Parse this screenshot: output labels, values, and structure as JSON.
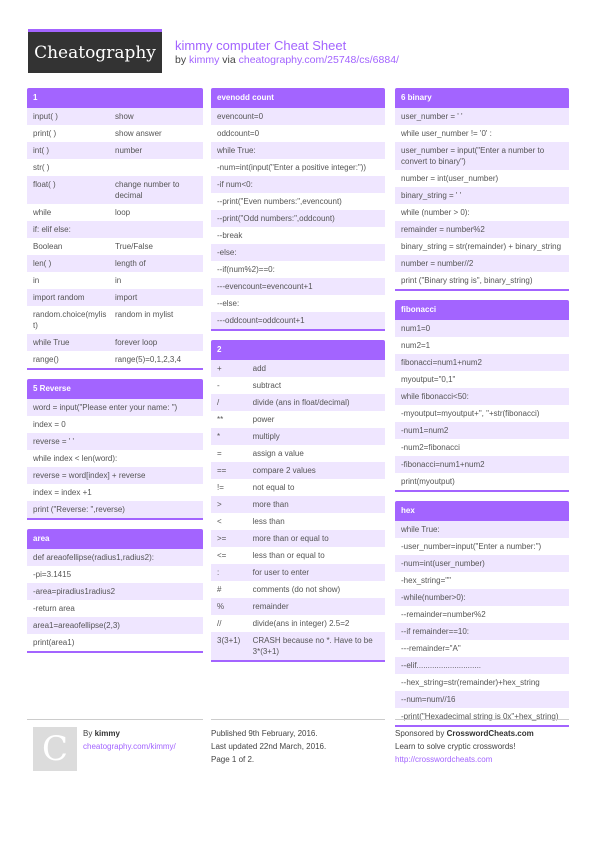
{
  "header": {
    "logo": "Cheatography",
    "title": "kimmy computer Cheat Sheet",
    "by": "by",
    "author": "kimmy",
    "via": "via",
    "url": "cheatography.com/25748/cs/6884/"
  },
  "sections": {
    "s1": {
      "title": "1",
      "rows": [
        [
          "input( )",
          "show"
        ],
        [
          "print( )",
          "show answer"
        ],
        [
          "int( )",
          "number"
        ],
        [
          "str( )",
          ""
        ],
        [
          "float( )",
          "change number to decimal"
        ],
        [
          "while",
          "loop"
        ],
        [
          "if: elif else:",
          ""
        ],
        [
          "Boolean",
          "True/False"
        ],
        [
          "len( )",
          "length of"
        ],
        [
          "in",
          "in"
        ],
        [
          "import random",
          "import"
        ],
        [
          "random.choice(mylist)",
          "random in mylist"
        ],
        [
          "while True",
          "forever loop"
        ],
        [
          "range()",
          "range(5)=0,1,2,3,4"
        ]
      ]
    },
    "reverse": {
      "title": "5 Reverse",
      "rows": [
        "word = input(\"Please enter your name: \")",
        "index = 0",
        "reverse = ' '",
        "while index < len(word):",
        "reverse = word[index] + reverse",
        "index = index +1",
        "print (\"Reverse: \",reverse)"
      ]
    },
    "area": {
      "title": "area",
      "rows": [
        "def areaofellipse(radius1,radius2):",
        "-pi=3.1415",
        "-area=piradius1radius2",
        "-return area",
        "area1=areaofellipse(2,3)",
        "print(area1)"
      ]
    },
    "evenodd": {
      "title": "evenodd count",
      "rows": [
        "evencount=0",
        "oddcount=0",
        "while True:",
        "-num=int(input(\"Enter a positive integer:\"))",
        "-if num<0:",
        "--print(\"Even numbers:\",evencount)",
        "--print(\"Odd numbers:\",oddcount)",
        "--break",
        "-else:",
        "--if(num%2)==0:",
        "---evencount=evencount+1",
        "--else:",
        "---oddcount=oddcount+1"
      ]
    },
    "s2": {
      "title": "2",
      "rows": [
        [
          "+",
          "add"
        ],
        [
          "-",
          "subtract"
        ],
        [
          "/",
          "divide (ans in float/decimal)"
        ],
        [
          "**",
          "power"
        ],
        [
          "*",
          "multiply"
        ],
        [
          "=",
          "assign a value"
        ],
        [
          "==",
          "compare 2 values"
        ],
        [
          "!=",
          "not equal to"
        ],
        [
          ">",
          "more than"
        ],
        [
          "<",
          "less than"
        ],
        [
          ">=",
          "more than or equal to"
        ],
        [
          "<=",
          "less than or equal to"
        ],
        [
          ":",
          "for user to enter"
        ],
        [
          "#",
          "comments (do not show)"
        ],
        [
          "%",
          "remainder"
        ],
        [
          "//",
          "divide(ans in integer) 2.5=2"
        ],
        [
          "3(3+1)",
          "CRASH because no *. Have to be 3*(3+1)"
        ]
      ]
    },
    "binary": {
      "title": "6 binary",
      "rows": [
        "user_number = ' '",
        "while user_number != '0' :",
        "user_number = input(\"Enter a number to convert to binary\")",
        "number = int(user_number)",
        "binary_string = ' '",
        "while (number > 0):",
        "remainder = number%2",
        "binary_string = str(remainder) + binary_string",
        "number = number//2",
        "print (\"Binary string is\", binary_string)"
      ]
    },
    "fibonacci": {
      "title": "fibonacci",
      "rows": [
        "num1=0",
        "num2=1",
        "fibonacci=num1+num2",
        "myoutput=\"0,1\"",
        "while fibonacci<50:",
        "-myoutput=myoutput+\", \"+str(fibonacci)",
        "-num1=num2",
        "-num2=fibonacci",
        "-fibonacci=num1+num2",
        "print(myoutput)"
      ]
    },
    "hex": {
      "title": "hex",
      "rows": [
        "while True:",
        "-user_number=input(\"Enter a number:\")",
        "-num=int(user_number)",
        "-hex_string=\"\"",
        "-while(number>0):",
        "--remainder=number%2",
        "--if remainder==10:",
        "---remainder=\"A\"",
        "--elif.............................",
        "--hex_string=str(remainder)+hex_string",
        "--num=num//16",
        "-print(\"Hexadecimal string is 0x\"+hex_string)"
      ]
    }
  },
  "footer": {
    "avatar_letter": "C",
    "by": "By",
    "author": "kimmy",
    "author_url": "cheatography.com/kimmy/",
    "published": "Published 9th February, 2016.",
    "updated": "Last updated 22nd March, 2016.",
    "page": "Page 1 of 2.",
    "sponsored_by": "Sponsored by",
    "sponsor": "CrosswordCheats.com",
    "sponsor_tagline": "Learn to solve cryptic crosswords!",
    "sponsor_url": "http://crosswordcheats.com"
  }
}
